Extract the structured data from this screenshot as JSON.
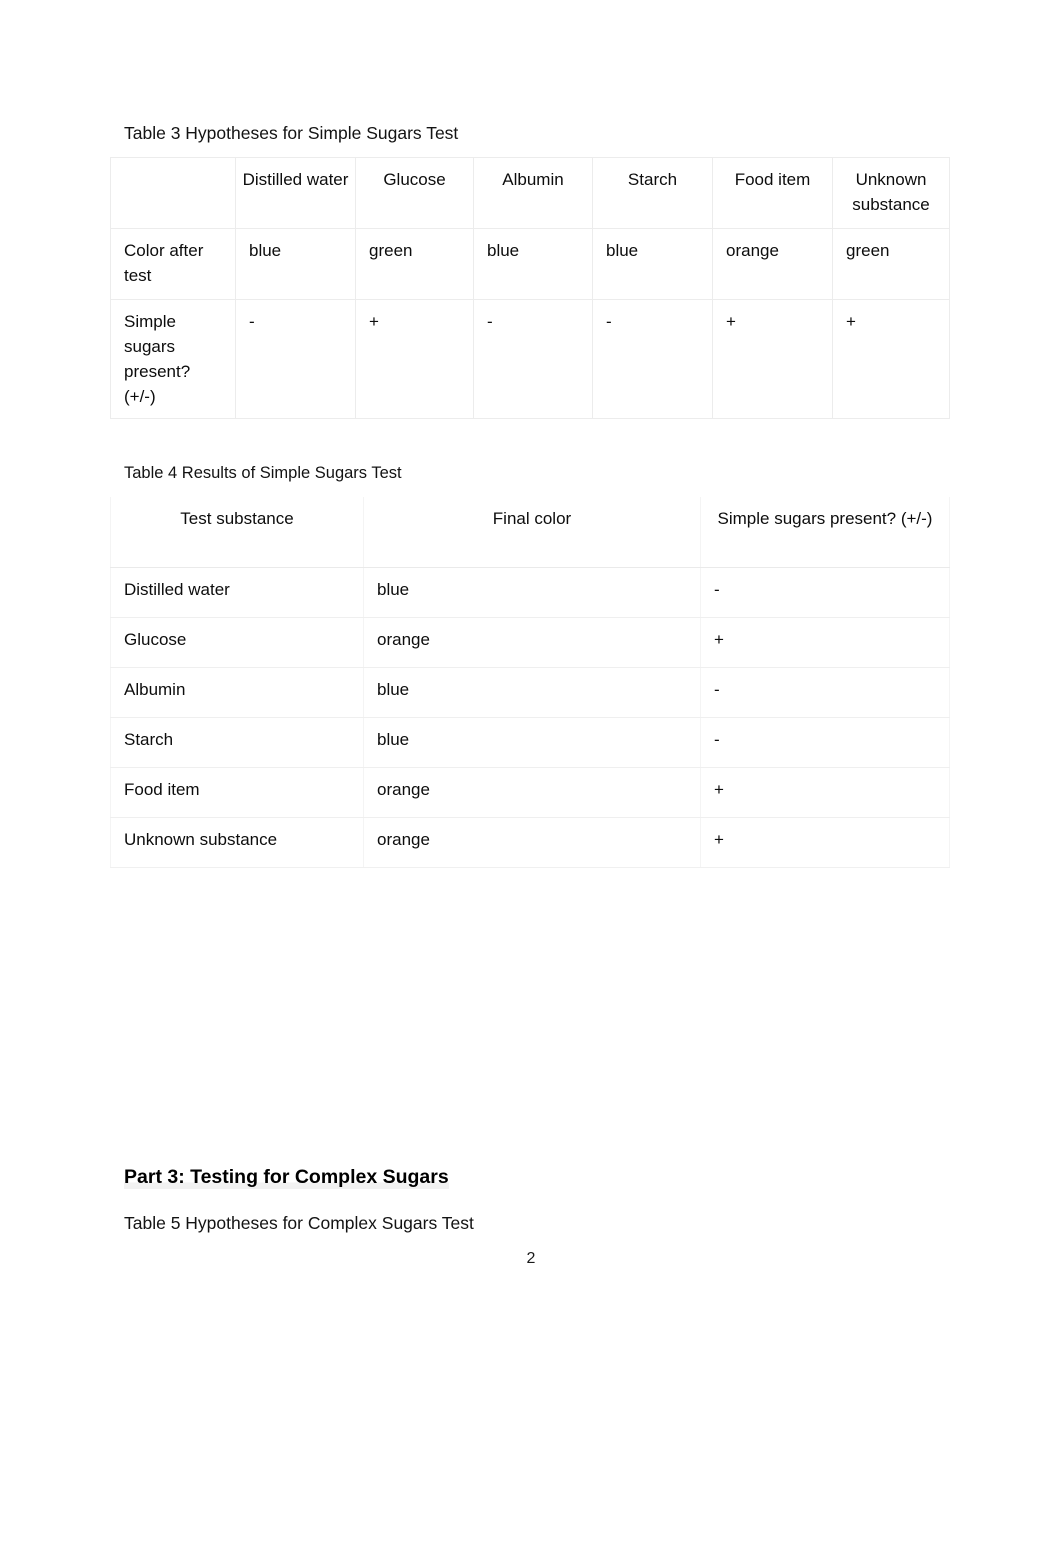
{
  "document": {
    "page_number": "2",
    "background": "#ffffff",
    "text_color": "#0d0d0d",
    "border_color": "#ececec"
  },
  "table3": {
    "caption": "Table 3 Hypotheses for Simple Sugars Test",
    "columns": [
      "",
      "Distilled water",
      "Glucose",
      "Albumin",
      "Starch",
      "Food item",
      "Unknown substance"
    ],
    "rows": [
      {
        "label": "Color after test",
        "values": [
          "blue",
          "green",
          "blue",
          "blue",
          "orange",
          "green"
        ]
      },
      {
        "label": "Simple sugars present? (+/-)",
        "values": [
          "-",
          "+",
          "-",
          "-",
          "+",
          "+"
        ]
      }
    ]
  },
  "table4": {
    "caption": "Table 4 Results of Simple Sugars Test",
    "columns": [
      "Test substance",
      "Final color",
      "Simple sugars present? (+/-)"
    ],
    "rows": [
      {
        "substance": "Distilled water",
        "color": "blue",
        "present": "-"
      },
      {
        "substance": "Glucose",
        "color": "orange",
        "present": "+"
      },
      {
        "substance": "Albumin",
        "color": "blue",
        "present": "-"
      },
      {
        "substance": "Starch",
        "color": "blue",
        "present": "-"
      },
      {
        "substance": "Food item",
        "color": "orange",
        "present": "+"
      },
      {
        "substance": "Unknown substance",
        "color": "orange",
        "present": "+"
      }
    ]
  },
  "part3": {
    "heading": "Part 3: Testing for Complex Sugars",
    "table5_caption": "Table 5 Hypotheses for Complex Sugars Test"
  }
}
